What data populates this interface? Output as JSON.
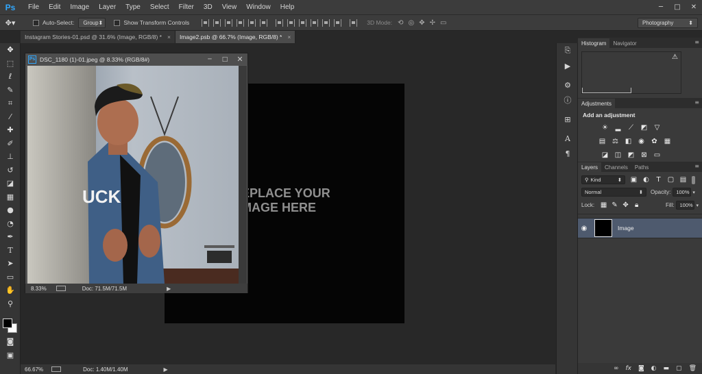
{
  "app": {
    "logo": "Ps",
    "menus": [
      "File",
      "Edit",
      "Image",
      "Layer",
      "Type",
      "Select",
      "Filter",
      "3D",
      "View",
      "Window",
      "Help"
    ],
    "window_controls": [
      "─",
      "□",
      "✕"
    ]
  },
  "options": {
    "auto_select_label": "Auto-Select:",
    "auto_select_value": "Group",
    "transform_label": "Show Transform Controls",
    "mode_label": "3D Mode:",
    "workspace": "Photography"
  },
  "tabs": [
    {
      "label": "Instagram Stories-01.psd @ 31.6% (Image, RGB/8) *",
      "active": false
    },
    {
      "label": "Image2.psb @ 66.7% (Image, RGB/8) *",
      "active": true
    }
  ],
  "float_window": {
    "title": "DSC_1180 (1)-01.jpeg @ 8.33% (RGB/8#)",
    "zoom": "8.33%",
    "doc": "Doc: 71.5M/71.5M"
  },
  "canvas": {
    "placeholder_line1": "EPLACE YOUR",
    "placeholder_line2": "MAGE HERE"
  },
  "status": {
    "zoom": "66.67%",
    "doc": "Doc: 1.40M/1.40M"
  },
  "panels": {
    "histogram_tab": "Histogram",
    "navigator_tab": "Navigator",
    "adjustments_tab": "Adjustments",
    "add_adjustment": "Add an adjustment",
    "layers_tab": "Layers",
    "channels_tab": "Channels",
    "paths_tab": "Paths",
    "kind": "Kind",
    "blend_mode": "Normal",
    "opacity_label": "Opacity:",
    "opacity_value": "100%",
    "lock_label": "Lock:",
    "fill_label": "Fill:",
    "fill_value": "100%",
    "layer_name": "Image"
  }
}
